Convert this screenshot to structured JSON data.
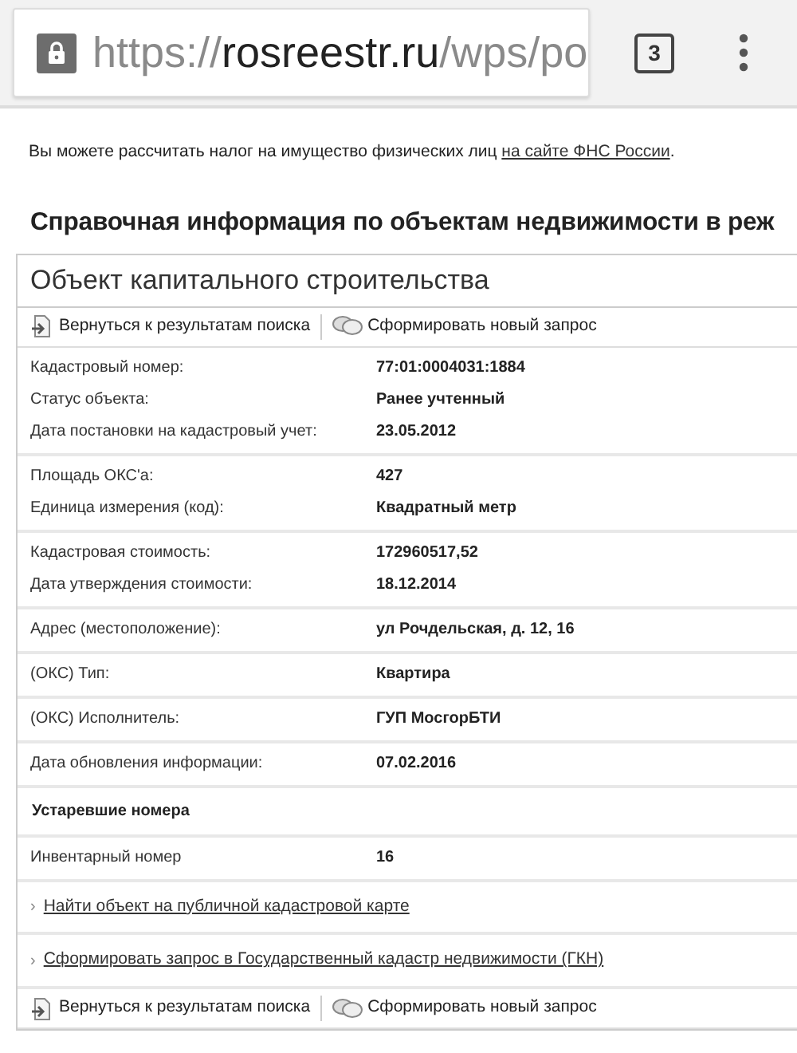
{
  "browser": {
    "url_parts": [
      {
        "text": "https://",
        "emphasis": false
      },
      {
        "text": "rosreestr.ru",
        "emphasis": true
      },
      {
        "text": "/wps/po",
        "emphasis": false
      }
    ],
    "tab_count": "3"
  },
  "note": {
    "text": "Вы можете рассчитать налог на имущество физических лиц ",
    "link": "на сайте ФНС России",
    "after": "."
  },
  "heading": "Справочная информация по объектам недвижимости в реж",
  "panel": {
    "title": "Объект капитального строительства",
    "toolbar": [
      {
        "kind": "back",
        "label": "Вернуться к результатам поиска"
      },
      {
        "kind": "new",
        "label": "Сформировать новый запрос"
      }
    ],
    "groups": [
      [
        {
          "label": "Кадастровый номер:",
          "value": "77:01:0004031:1884"
        },
        {
          "label": "Статус объекта:",
          "value": "Ранее учтенный"
        },
        {
          "label": "Дата постановки на кадастровый учет:",
          "value": "23.05.2012"
        }
      ],
      [
        {
          "label": "Площадь ОКС'а:",
          "value": "427"
        },
        {
          "label": "Единица измерения (код):",
          "value": "Квадратный метр"
        }
      ],
      [
        {
          "label": "Кадастровая стоимость:",
          "value": "172960517,52"
        },
        {
          "label": "Дата утверждения стоимости:",
          "value": "18.12.2014"
        }
      ],
      [
        {
          "label": "Адрес (местоположение):",
          "value": "ул Рочдельская, д. 12, 16"
        }
      ],
      [
        {
          "label": "(ОКС) Тип:",
          "value": "Квартира"
        }
      ],
      [
        {
          "label": "(ОКС) Исполнитель:",
          "value": "ГУП МосгорБТИ"
        }
      ],
      [
        {
          "label": "Дата обновления информации:",
          "value": "07.02.2016"
        }
      ]
    ],
    "section_title": "Устаревшие номера",
    "obsolete": [
      {
        "label": "Инвентарный номер",
        "value": "16"
      }
    ],
    "links": [
      {
        "marker": "›",
        "text": "Найти объект на публичной кадастровой карте"
      },
      {
        "marker": "›",
        "text": "Сформировать запрос в Государственный кадастр недвижимости (ГКН)"
      }
    ],
    "bottom_toolbar": [
      {
        "kind": "back",
        "label": "Вернуться к результатам поиска"
      },
      {
        "kind": "new",
        "label": "Сформировать новый запрос"
      }
    ]
  }
}
